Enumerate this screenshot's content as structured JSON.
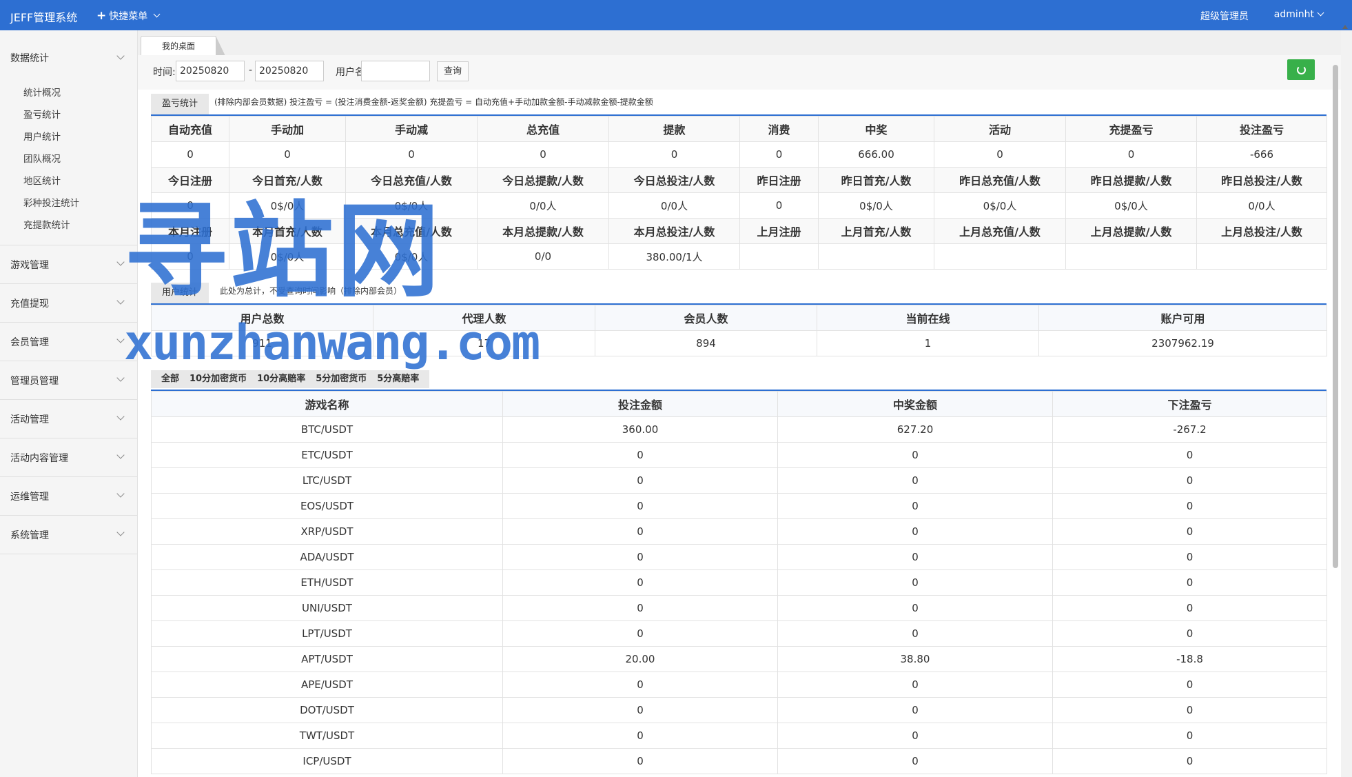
{
  "header": {
    "title": "JEFF管理系统",
    "quick_menu": "快捷菜单",
    "role": "超级管理员",
    "username": "adminht"
  },
  "sidebar": {
    "groups": [
      {
        "label": "数据统计",
        "items": [
          "统计概况",
          "盈亏统计",
          "用户统计",
          "团队概况",
          "地区统计",
          "彩种投注统计",
          "充提款统计"
        ]
      },
      {
        "label": "游戏管理"
      },
      {
        "label": "充值提现"
      },
      {
        "label": "会员管理"
      },
      {
        "label": "管理员管理"
      },
      {
        "label": "活动管理"
      },
      {
        "label": "活动内容管理"
      },
      {
        "label": "运维管理"
      },
      {
        "label": "系统管理"
      }
    ]
  },
  "tabs": {
    "desktop": "我的桌面"
  },
  "filter": {
    "time_label": "时间:",
    "start": "20250820",
    "dash": "-",
    "end": "20250820",
    "user_label": "用户名:",
    "user_value": "",
    "query": "查询"
  },
  "profit": {
    "tab": "盈亏统计",
    "note": "(排除内部会员数据)  投注盈亏 = (投注消费金额-返奖金额)     充提盈亏 = 自动充值+手动加款金额-手动减款金额-提款金额",
    "headers1": [
      "自动充值",
      "手动加",
      "手动减",
      "总充值",
      "提款",
      "消费",
      "中奖",
      "活动",
      "充提盈亏",
      "投注盈亏"
    ],
    "values1": [
      "0",
      "0",
      "0",
      "0",
      "0",
      "0",
      "666.00",
      "0",
      "0",
      "-666"
    ],
    "headers2": [
      "今日注册",
      "今日首充/人数",
      "今日总充值/人数",
      "今日总提款/人数",
      "今日总投注/人数",
      "昨日注册",
      "昨日首充/人数",
      "昨日总充值/人数",
      "昨日总提款/人数",
      "昨日总投注/人数"
    ],
    "values2": [
      "0",
      "0$/0人",
      "0$/0人",
      "0/0人",
      "0/0人",
      "0",
      "0$/0人",
      "0$/0人",
      "0$/0人",
      "0/0人"
    ],
    "headers3": [
      "本月注册",
      "本月首充/人数",
      "本月总充值/人数",
      "本月总提款/人数",
      "本月总投注/人数",
      "上月注册",
      "上月首充/人数",
      "上月总充值/人数",
      "上月总提款/人数",
      "上月总投注/人数"
    ],
    "values3": [
      "0",
      "0$/0人",
      "0$/0人",
      "0/0",
      "380.00/1人",
      "",
      "",
      "",
      "",
      ""
    ]
  },
  "users": {
    "tab": "用户统计",
    "note": "此处为总计，不受查询时间影响（排除内部会员）",
    "headers": [
      "用户总数",
      "代理人数",
      "会员人数",
      "当前在线",
      "账户可用"
    ],
    "values": [
      "911",
      "17",
      "894",
      "1",
      "2307962.19"
    ]
  },
  "games": {
    "tabs": [
      "全部",
      "10分加密货币",
      "10分高赔率",
      "5分加密货币",
      "5分高赔率"
    ],
    "headers": [
      "游戏名称",
      "投注金额",
      "中奖金额",
      "下注盈亏"
    ],
    "rows": [
      [
        "BTC/USDT",
        "360.00",
        "627.20",
        "-267.2"
      ],
      [
        "ETC/USDT",
        "0",
        "0",
        "0"
      ],
      [
        "LTC/USDT",
        "0",
        "0",
        "0"
      ],
      [
        "EOS/USDT",
        "0",
        "0",
        "0"
      ],
      [
        "XRP/USDT",
        "0",
        "0",
        "0"
      ],
      [
        "ADA/USDT",
        "0",
        "0",
        "0"
      ],
      [
        "ETH/USDT",
        "0",
        "0",
        "0"
      ],
      [
        "UNI/USDT",
        "0",
        "0",
        "0"
      ],
      [
        "LPT/USDT",
        "0",
        "0",
        "0"
      ],
      [
        "APT/USDT",
        "20.00",
        "38.80",
        "-18.8"
      ],
      [
        "APE/USDT",
        "0",
        "0",
        "0"
      ],
      [
        "DOT/USDT",
        "0",
        "0",
        "0"
      ],
      [
        "TWT/USDT",
        "0",
        "0",
        "0"
      ],
      [
        "ICP/USDT",
        "0",
        "0",
        "0"
      ]
    ]
  },
  "watermark": {
    "line1": "寻站网",
    "line2": "xunzhanwang.com"
  },
  "colors": {
    "header": "#2d6fd2",
    "refresh": "#38b04a"
  }
}
